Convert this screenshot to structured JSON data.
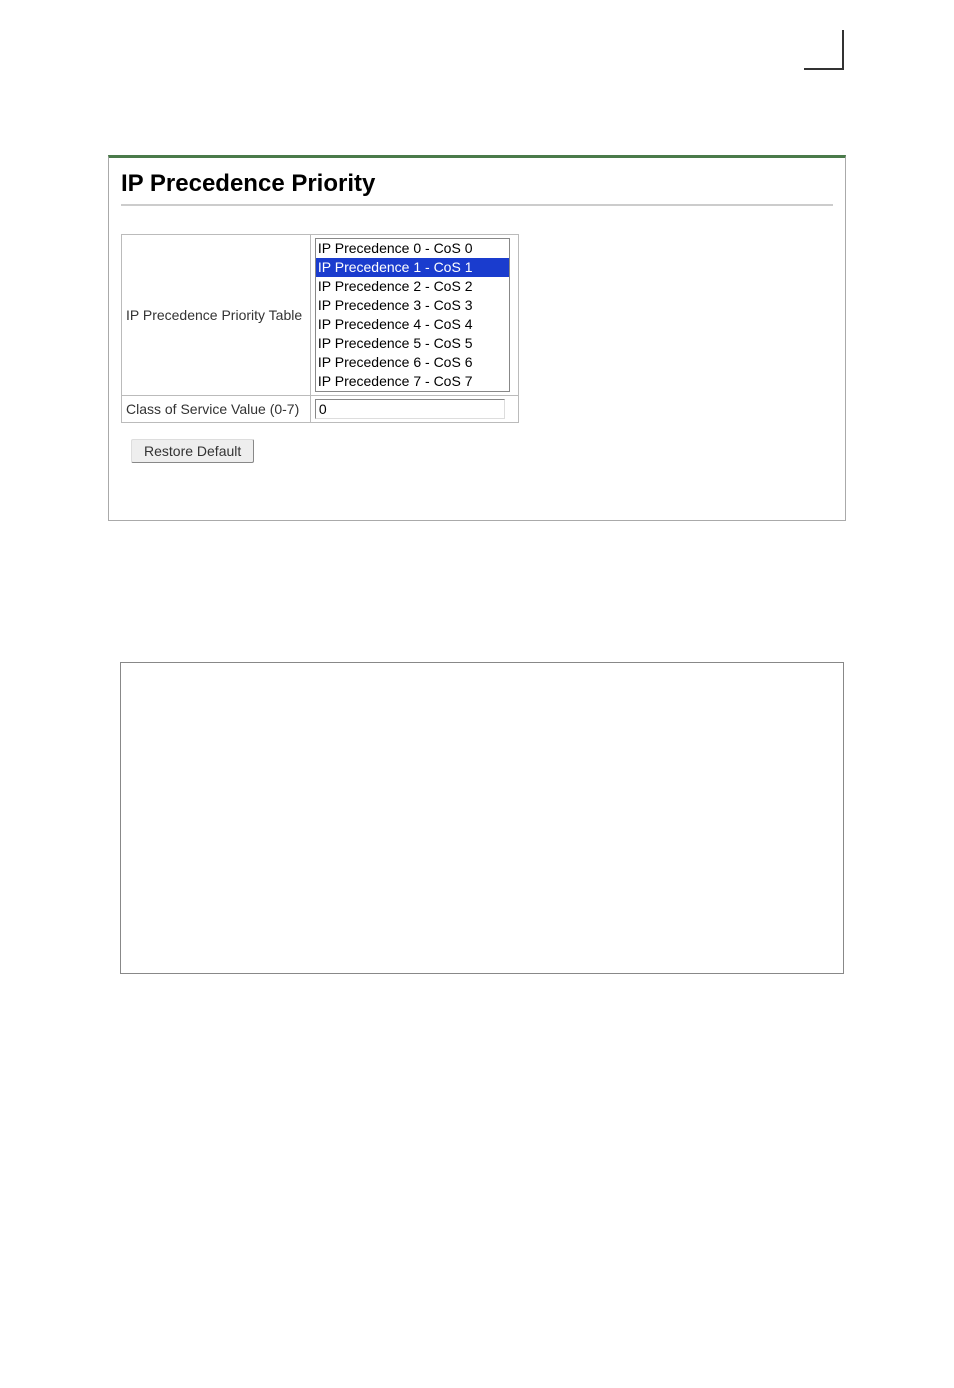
{
  "page": {
    "title": "IP Precedence Priority"
  },
  "table": {
    "row1_label": "IP Precedence Priority Table",
    "options": [
      "IP Precedence 0 - CoS 0",
      "IP Precedence 1 - CoS 1",
      "IP Precedence 2 - CoS 2",
      "IP Precedence 3 - CoS 3",
      "IP Precedence 4 - CoS 4",
      "IP Precedence 5 - CoS 5",
      "IP Precedence 6 - CoS 6",
      "IP Precedence 7 - CoS 7"
    ],
    "selected_index": 1,
    "row2_label": "Class of Service Value (0-7)",
    "cos_value": "0"
  },
  "buttons": {
    "restore_default": "Restore Default"
  }
}
